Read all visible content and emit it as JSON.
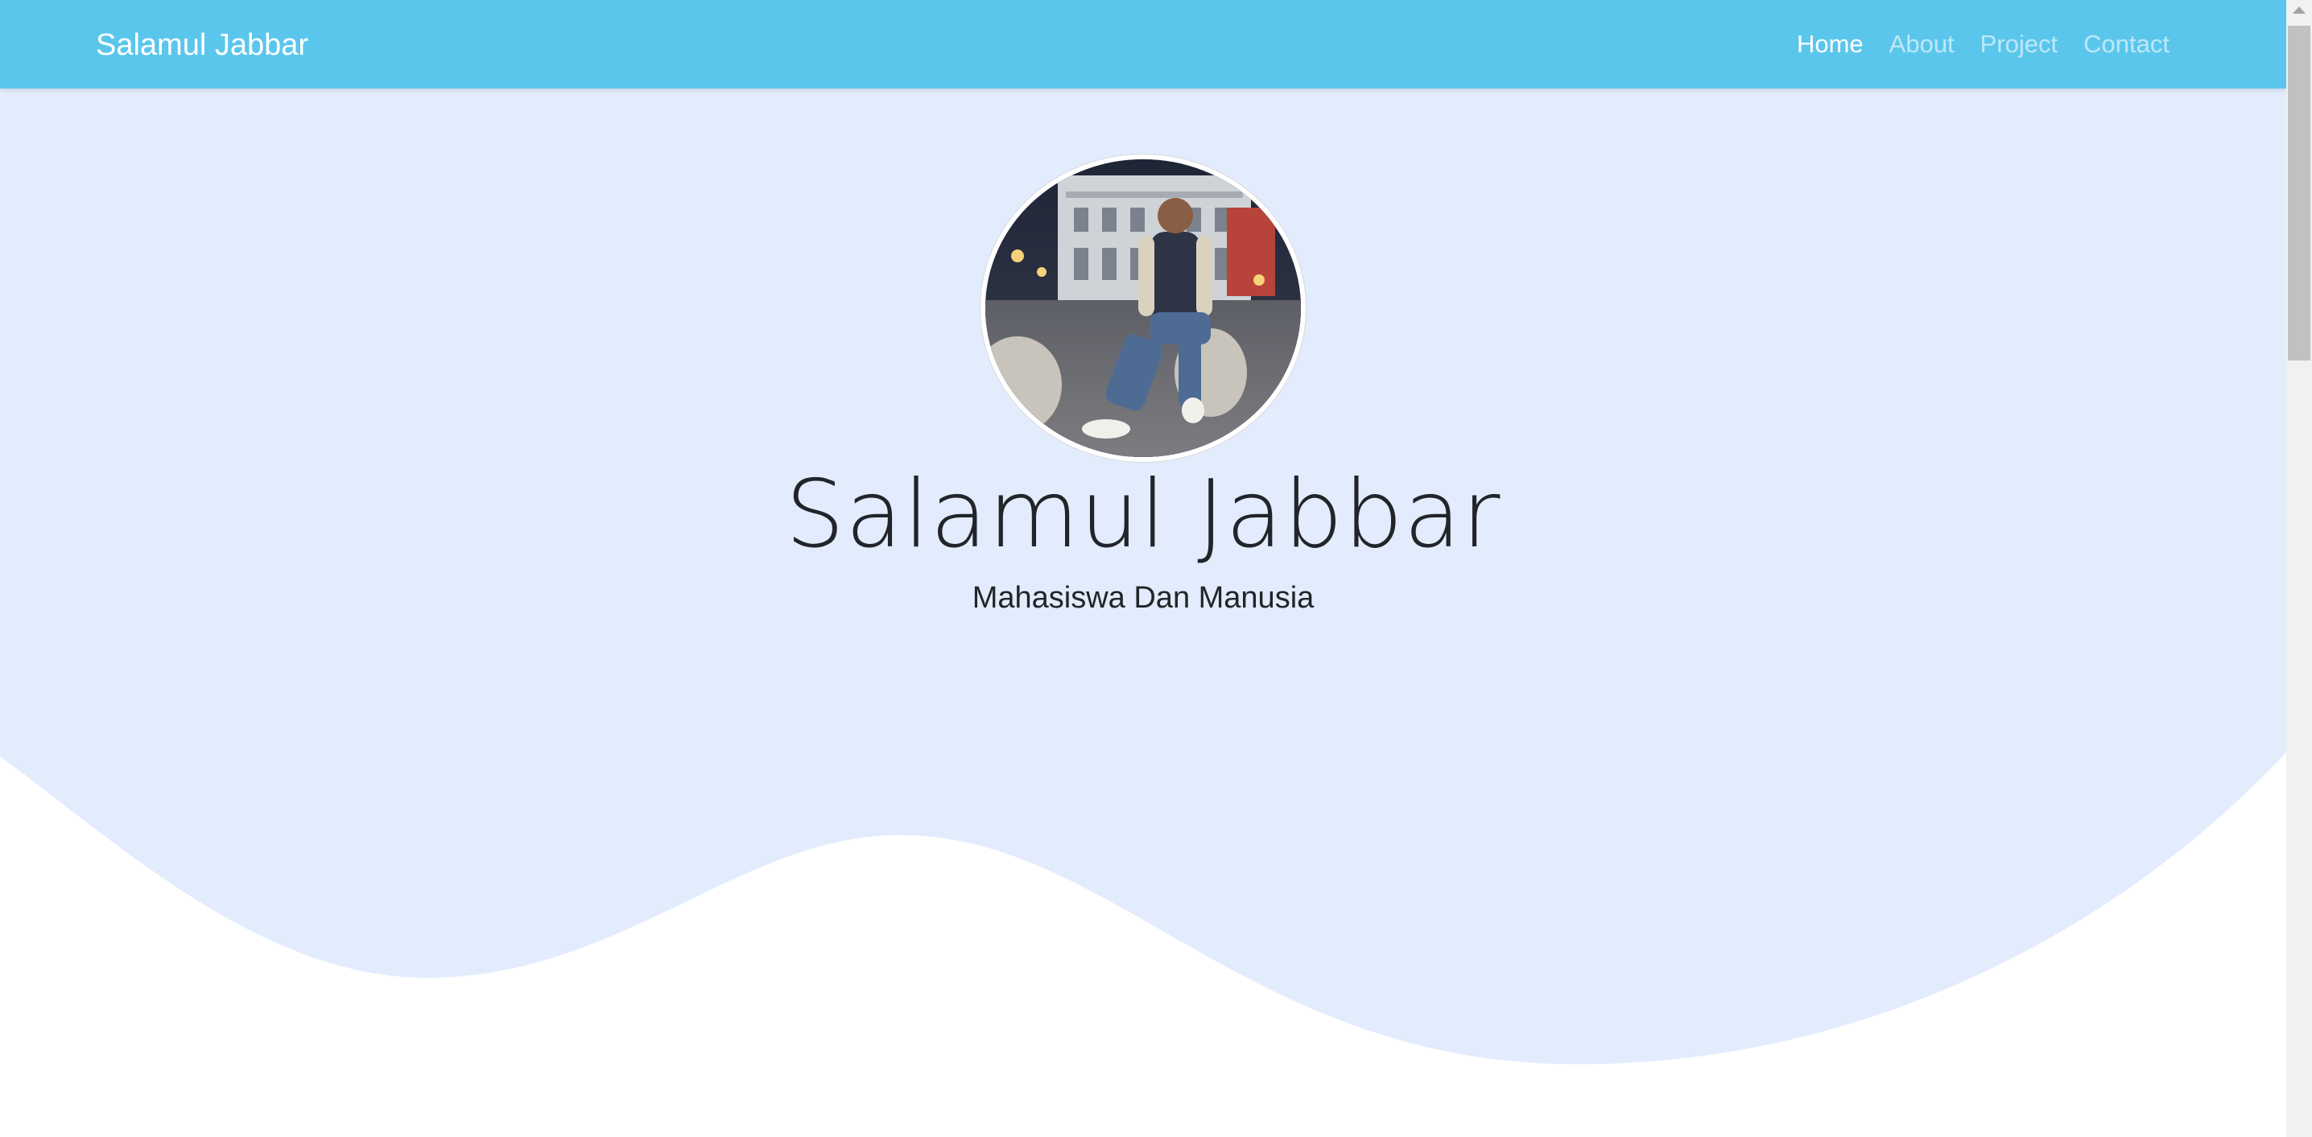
{
  "navbar": {
    "brand": "Salamul Jabbar",
    "links": [
      {
        "label": "Home",
        "active": true
      },
      {
        "label": "About",
        "active": false
      },
      {
        "label": "Project",
        "active": false
      },
      {
        "label": "Contact",
        "active": false
      }
    ]
  },
  "hero": {
    "title": "Salamul Jabbar",
    "subtitle": "Mahasiswa Dan Manusia"
  },
  "colors": {
    "navbar_bg": "#5bc6ec",
    "hero_bg": "#e2ecfd",
    "page_bg": "#ffffff",
    "text": "#212529"
  }
}
